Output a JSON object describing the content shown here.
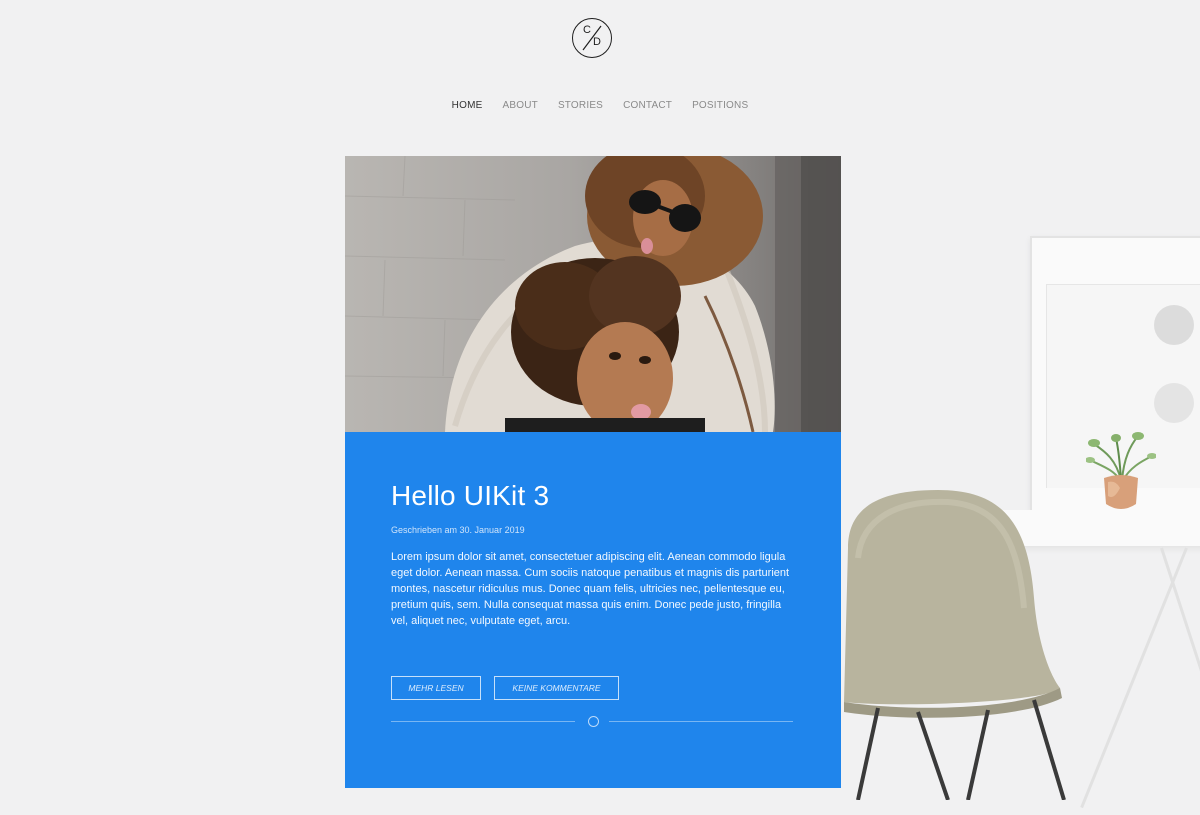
{
  "brand": {
    "logo_letter_top": "C",
    "logo_letter_bottom": "D"
  },
  "nav": {
    "items": [
      {
        "label": "HOME",
        "active": true
      },
      {
        "label": "ABOUT",
        "active": false
      },
      {
        "label": "STORIES",
        "active": false
      },
      {
        "label": "CONTACT",
        "active": false
      },
      {
        "label": "POSITIONS",
        "active": false
      }
    ]
  },
  "post": {
    "title": "Hello UIKit 3",
    "meta": "Geschrieben am 30. Januar 2019",
    "excerpt": "Lorem ipsum dolor sit amet, consectetuer adipiscing elit. Aenean commodo ligula eget dolor. Aenean massa. Cum sociis natoque penatibus et magnis dis parturient montes, nascetur ridiculus mus. Donec quam felis, ultricies nec, pellentesque eu, pretium quis, sem. Nulla consequat massa quis enim. Donec pede justo, fringilla vel, aliquet nec, vulputate eget, arcu.",
    "read_more_label": "MEHR LESEN",
    "comments_label": "KEINE KOMMENTARE",
    "image_icon": "photo-mother-and-daughter"
  },
  "colors": {
    "accent": "#1f85ec",
    "background": "#f1f1f2",
    "nav_active": "#333333",
    "nav_inactive": "#8a8a8a"
  }
}
